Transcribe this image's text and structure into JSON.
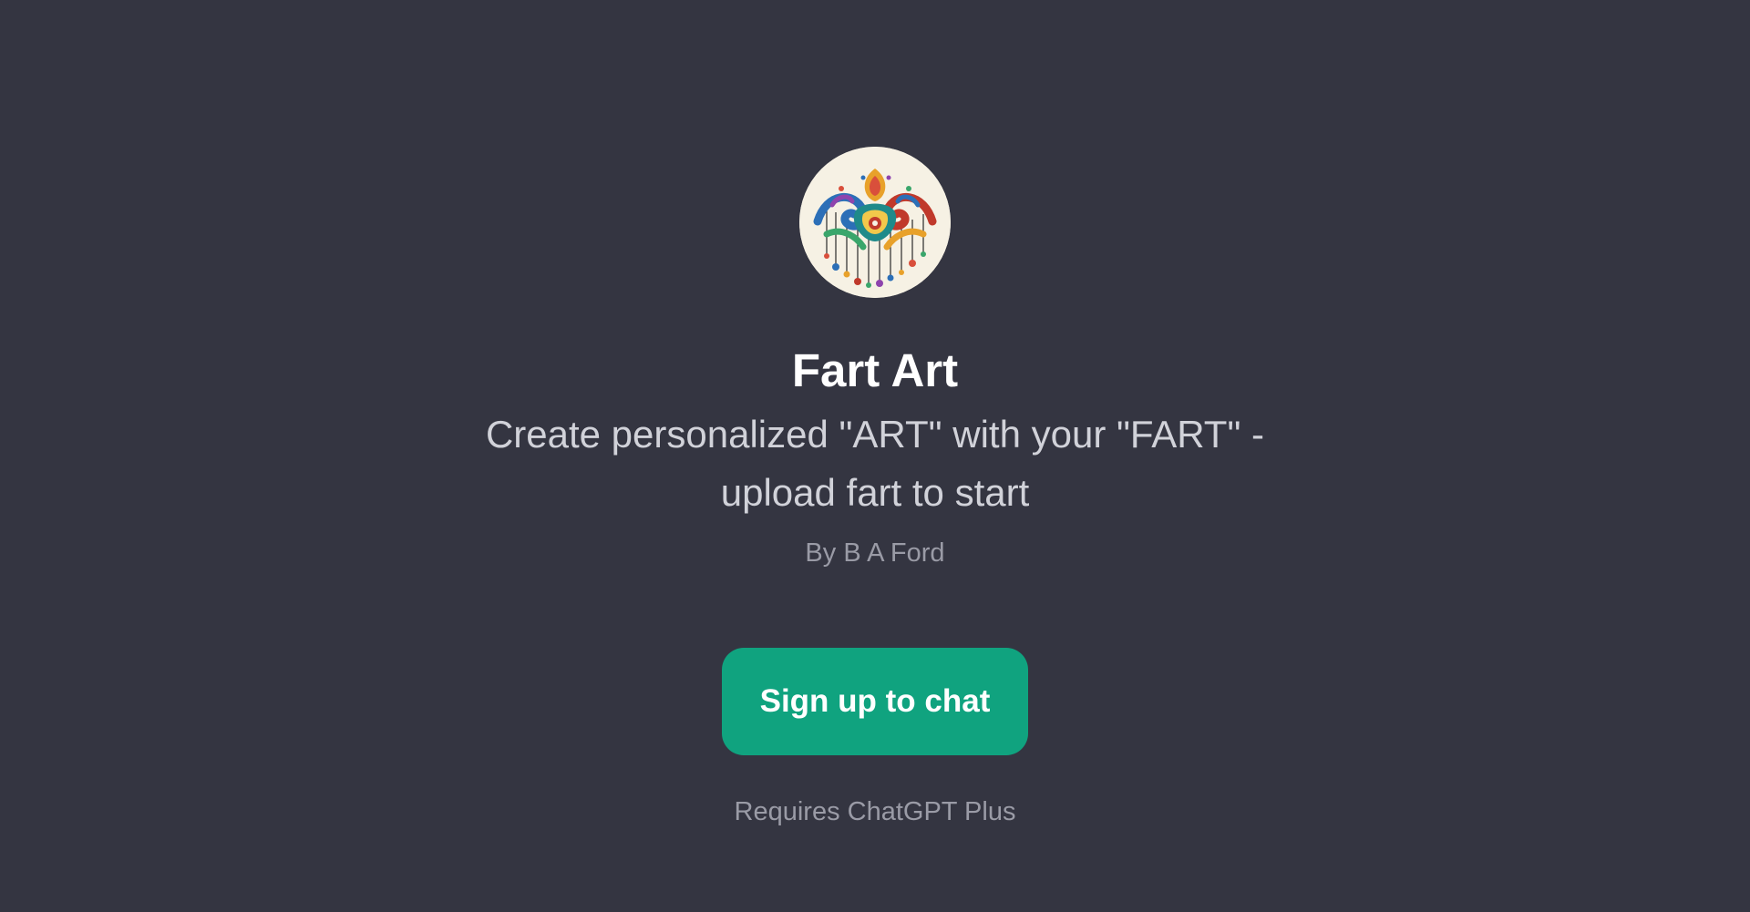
{
  "gpt": {
    "avatar_icon": "abstract-swirl-art-icon",
    "title": "Fart Art",
    "description": "Create personalized \"ART\" with your \"FART\" - upload fart to start",
    "author": "By B A Ford"
  },
  "actions": {
    "signup_label": "Sign up to chat",
    "requirement": "Requires ChatGPT Plus"
  },
  "colors": {
    "background": "#343541",
    "accent": "#10a37f",
    "title": "#ffffff",
    "description": "#d1d2d9",
    "muted": "#9a9ba6"
  }
}
